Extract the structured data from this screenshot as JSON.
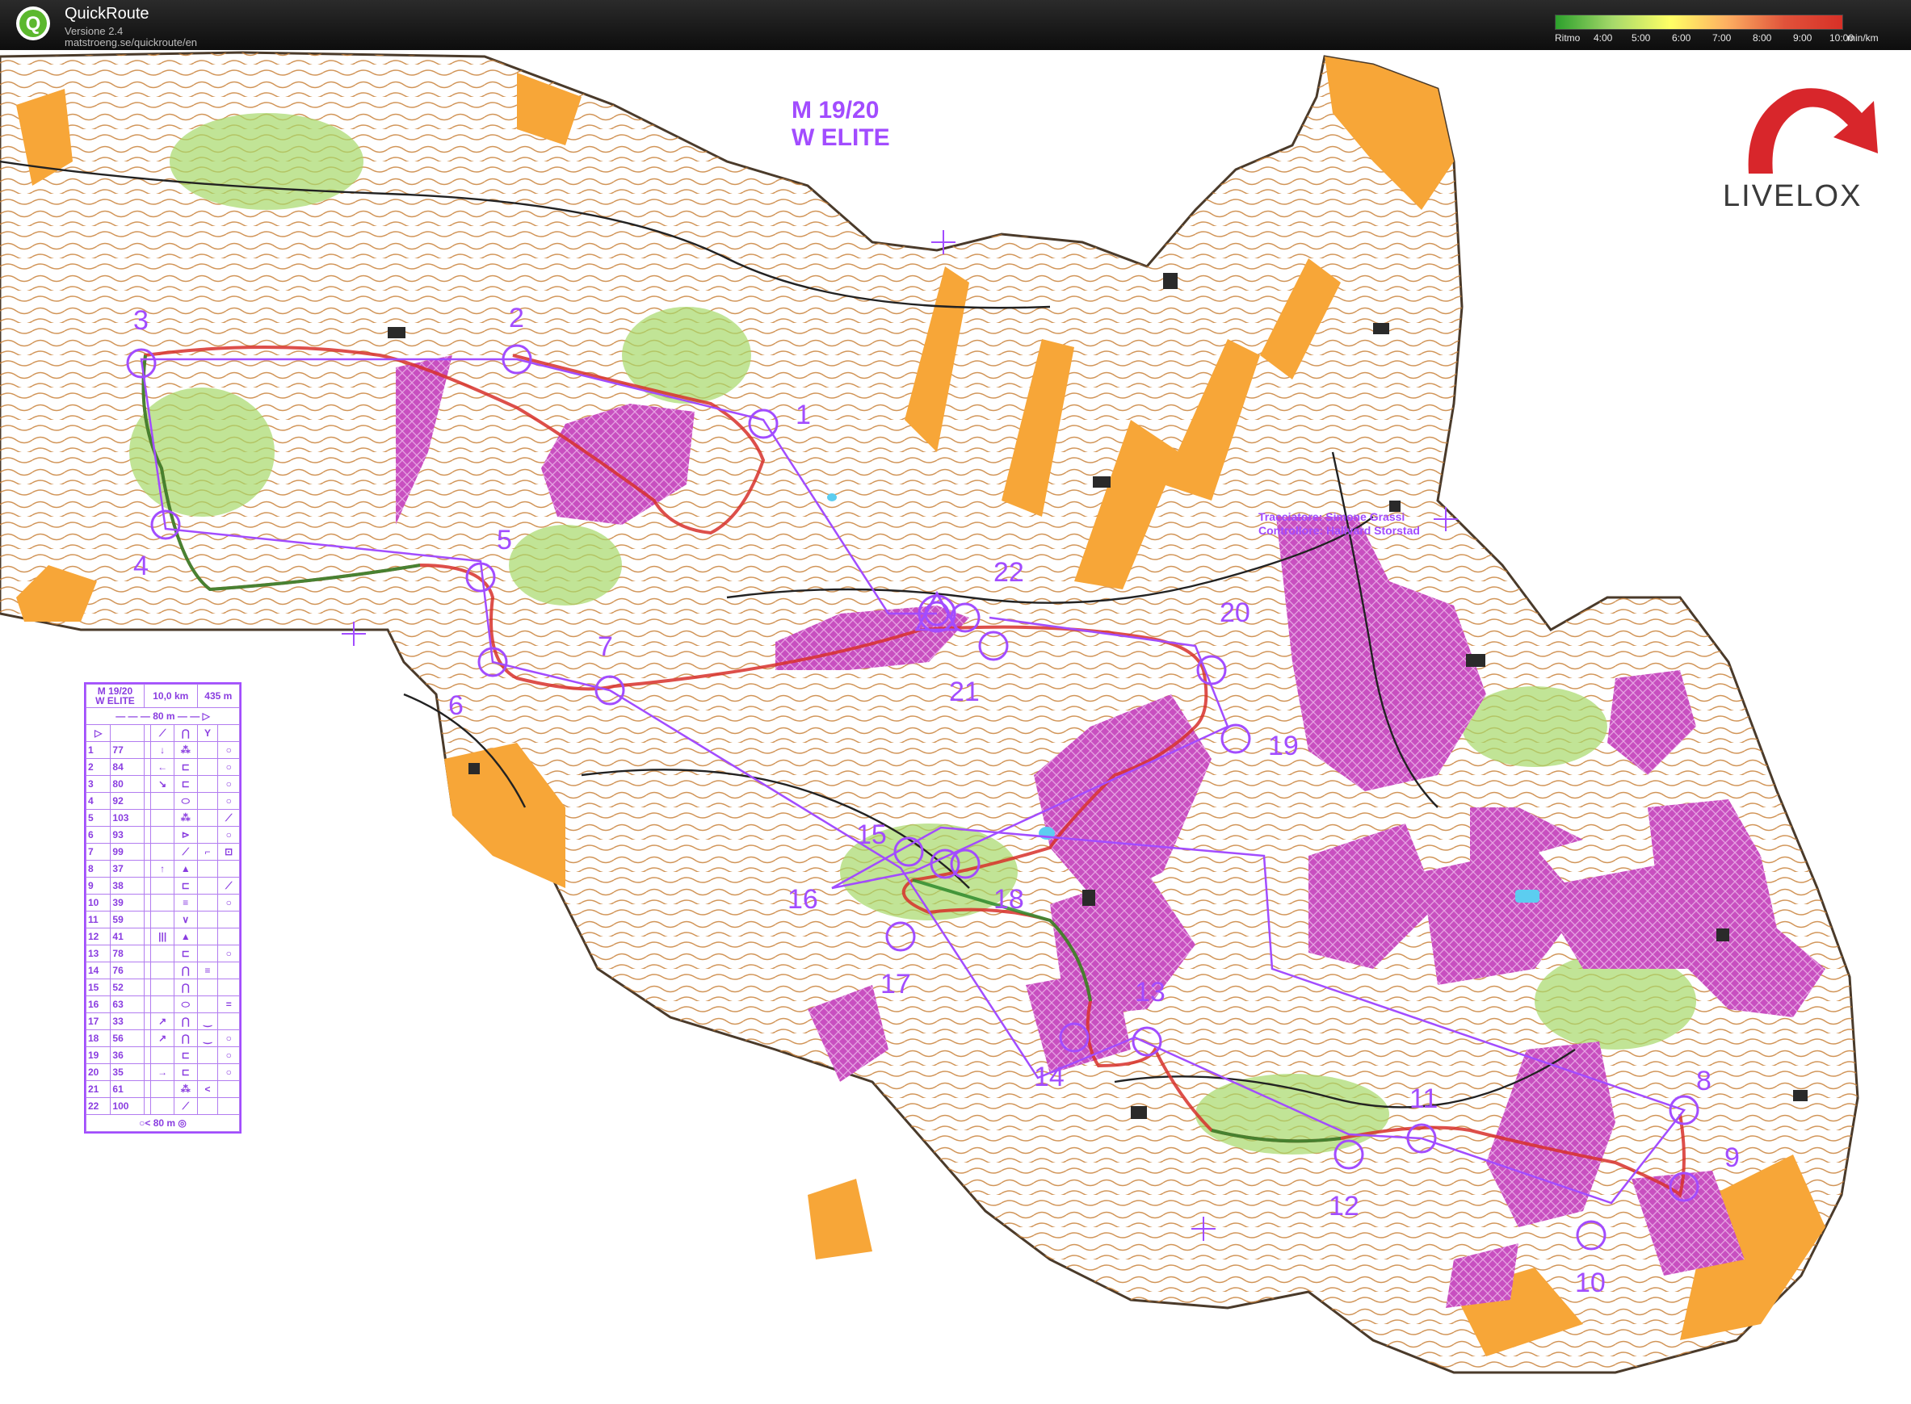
{
  "app": {
    "name": "QuickRoute",
    "version": "Versione 2.4",
    "url": "matstroeng.se/quickroute/en",
    "logo_letter": "Q"
  },
  "pace_legend": {
    "label": "Ritmo",
    "ticks": [
      "4:00",
      "5:00",
      "6:00",
      "7:00",
      "8:00",
      "9:00",
      "10:00"
    ],
    "unit": "min/km",
    "colors": [
      "#2ca02c",
      "#a6d96a",
      "#ffff66",
      "#fdae61",
      "#e0523a",
      "#d73027"
    ]
  },
  "course": {
    "title_line1": "M 19/20",
    "title_line2": "W ELITE",
    "distance": "10,0 km",
    "climb": "435 m",
    "start_dist": "80 m",
    "finish_dist": "80 m"
  },
  "credits": {
    "line1": "Tracciatore: Simone Grassi",
    "line2": "Controllore: Hallvard Storstad"
  },
  "brand": {
    "name": "LIVELOX"
  },
  "controls": [
    "1",
    "2",
    "3",
    "4",
    "5",
    "6",
    "7",
    "8",
    "9",
    "10",
    "11",
    "12",
    "13",
    "14",
    "15",
    "16",
    "17",
    "18",
    "19",
    "20",
    "21",
    "22"
  ],
  "control_descriptions": [
    {
      "n": "1",
      "code": "77",
      "c": "↓",
      "d": "⁂",
      "f": "",
      "g": "○"
    },
    {
      "n": "2",
      "code": "84",
      "c": "←",
      "d": "⊏",
      "f": "",
      "g": "○"
    },
    {
      "n": "3",
      "code": "80",
      "c": "↘",
      "d": "⊏",
      "f": "",
      "g": "○"
    },
    {
      "n": "4",
      "code": "92",
      "c": "",
      "d": "⬭",
      "f": "",
      "g": "○"
    },
    {
      "n": "5",
      "code": "103",
      "c": "",
      "d": "⁂",
      "f": "",
      "g": "⟋"
    },
    {
      "n": "6",
      "code": "93",
      "c": "",
      "d": "⊳",
      "f": "",
      "g": "○"
    },
    {
      "n": "7",
      "code": "99",
      "c": "",
      "d": "⟋",
      "f": "⌐",
      "g": "⊡"
    },
    {
      "n": "8",
      "code": "37",
      "c": "↑",
      "d": "▲",
      "f": "",
      "g": ""
    },
    {
      "n": "9",
      "code": "38",
      "c": "",
      "d": "⊏",
      "f": "",
      "g": "⟋"
    },
    {
      "n": "10",
      "code": "39",
      "c": "",
      "d": "≡",
      "f": "",
      "g": "○"
    },
    {
      "n": "11",
      "code": "59",
      "c": "",
      "d": "∨",
      "f": "",
      "g": ""
    },
    {
      "n": "12",
      "code": "41",
      "c": "|||",
      "d": "▲",
      "f": "",
      "g": ""
    },
    {
      "n": "13",
      "code": "78",
      "c": "",
      "d": "⊏",
      "f": "",
      "g": "○"
    },
    {
      "n": "14",
      "code": "76",
      "c": "",
      "d": "⋂",
      "f": "≡",
      "g": ""
    },
    {
      "n": "15",
      "code": "52",
      "c": "",
      "d": "⋂",
      "f": "",
      "g": ""
    },
    {
      "n": "16",
      "code": "63",
      "c": "",
      "d": "⬭",
      "f": "",
      "g": "="
    },
    {
      "n": "17",
      "code": "33",
      "c": "↗",
      "d": "⋂",
      "f": "‿",
      "g": ""
    },
    {
      "n": "18",
      "code": "56",
      "c": "↗",
      "d": "⋂",
      "f": "‿",
      "g": "○"
    },
    {
      "n": "19",
      "code": "36",
      "c": "",
      "d": "⊏",
      "f": "",
      "g": "○"
    },
    {
      "n": "20",
      "code": "35",
      "c": "→",
      "d": "⊏",
      "f": "",
      "g": "○"
    },
    {
      "n": "21",
      "code": "61",
      "c": "",
      "d": "⁂",
      "f": "<",
      "g": ""
    },
    {
      "n": "22",
      "code": "100",
      "c": "",
      "d": "⟋",
      "f": "",
      "g": ""
    }
  ]
}
